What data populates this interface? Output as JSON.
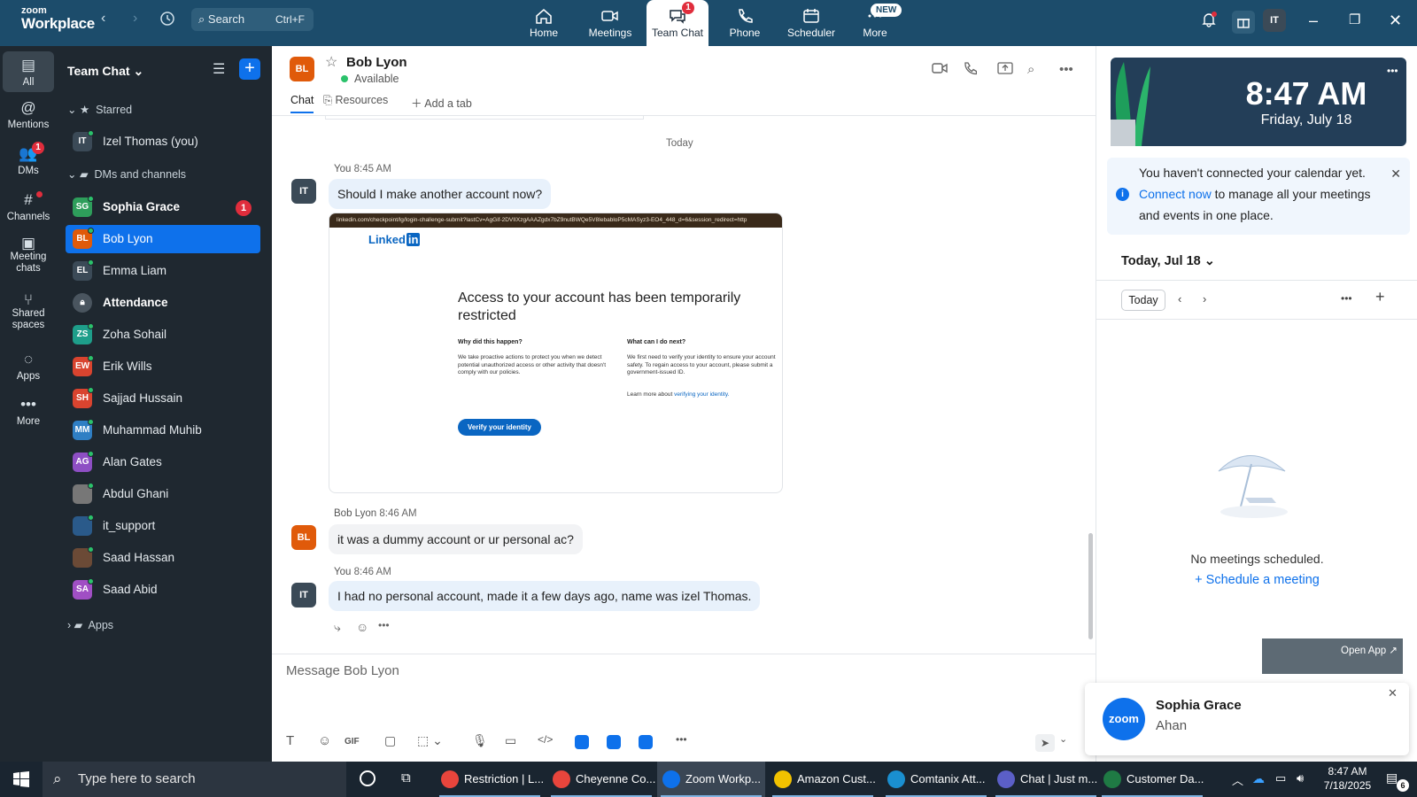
{
  "topbar": {
    "logo_top": "zoom",
    "logo_bottom": "Workplace",
    "search_label": "Search",
    "search_shortcut": "Ctrl+F",
    "tabs": [
      {
        "label": "Home"
      },
      {
        "label": "Meetings"
      },
      {
        "label": "Team Chat",
        "badge": "1"
      },
      {
        "label": "Phone"
      },
      {
        "label": "Scheduler"
      },
      {
        "label": "More",
        "badge": "NEW"
      }
    ],
    "user_initials": "IT"
  },
  "rail": {
    "items": [
      {
        "label": "All"
      },
      {
        "label": "Mentions"
      },
      {
        "label": "DMs",
        "badge": "1"
      },
      {
        "label": "Channels"
      },
      {
        "label": "Meeting chats"
      },
      {
        "label": "Shared spaces"
      },
      {
        "label": "Apps"
      },
      {
        "label": "More"
      }
    ]
  },
  "sidebar": {
    "title": "Team Chat",
    "starred_label": "Starred",
    "dms_label": "DMs and channels",
    "apps_label": "Apps",
    "starred": [
      {
        "initials": "IT",
        "name": "Izel Thomas (you)",
        "color": "#3b4a57"
      }
    ],
    "items": [
      {
        "initials": "SG",
        "name": "Sophia Grace",
        "color": "#2e9e5b",
        "unread": "1"
      },
      {
        "initials": "BL",
        "name": "Bob Lyon",
        "color": "#e05a0a"
      },
      {
        "initials": "EL",
        "name": "Emma Liam",
        "color": "#3b4a57"
      },
      {
        "initials": "",
        "name": "Attendance",
        "color": "#4a555f"
      },
      {
        "initials": "ZS",
        "name": "Zoha Sohail",
        "color": "#1e9e8a"
      },
      {
        "initials": "EW",
        "name": "Erik Wills",
        "color": "#d9442f"
      },
      {
        "initials": "SH",
        "name": "Sajjad Hussain",
        "color": "#d9442f"
      },
      {
        "initials": "MM",
        "name": "Muhammad Muhib",
        "color": "#2f7fc4"
      },
      {
        "initials": "AG",
        "name": "Alan Gates",
        "color": "#8e4fc4"
      },
      {
        "initials": "",
        "name": "Abdul Ghani",
        "color": "#777"
      },
      {
        "initials": "",
        "name": "it_support",
        "color": "#2a5a8a"
      },
      {
        "initials": "",
        "name": "Saad Hassan",
        "color": "#6b4a36"
      },
      {
        "initials": "SA",
        "name": "Saad Abid",
        "color": "#a04fc4"
      }
    ]
  },
  "chat": {
    "contact_initials": "BL",
    "contact_name": "Bob Lyon",
    "status": "Available",
    "tabs": [
      "Chat",
      "Resources",
      "Add a tab"
    ],
    "day_divider": "Today",
    "messages": [
      {
        "sender": "You",
        "time": "8:45 AM",
        "initials": "IT",
        "text": "Should I make another account now?"
      },
      {
        "sender": "Bob Lyon",
        "time": "8:46 AM",
        "initials": "BL",
        "text": "it was a dummy account or ur personal ac?"
      },
      {
        "sender": "You",
        "time": "8:46 AM",
        "initials": "IT",
        "text": "I had no personal account, made it a few days ago, name was izel Thomas."
      }
    ],
    "screenshot": {
      "url": "linkedin.com/checkpoint/lg/login-challenge-submit?lastCv=AgGif-2DVIIXzgAAAZgdx7bZ9nutBWQe5V8IebabloP5cMASyz3-EO4_448_d=6&session_redirect=http",
      "logo": "Linked",
      "logo_box": "in",
      "heading": "Access to your account has been temporarily restricted",
      "why_title": "Why did this happen?",
      "why_text": "We take proactive actions to protect you when we detect potential unauthorized access or other activity that doesn't comply with our policies.",
      "next_title": "What can I do next?",
      "next_text": "We first need to verify your identity to ensure your account safety. To regain access to your account, please submit a government-issued ID.",
      "learn_prefix": "Learn more about",
      "learn_link": "verifying your identity.",
      "button": "Verify your identity"
    },
    "compose_placeholder": "Message Bob Lyon",
    "gif_label": "GIF"
  },
  "right": {
    "time": "8:47 AM",
    "date": "Friday, July 18",
    "note_pre": "You haven't connected your calendar yet.",
    "note_link": "Connect now",
    "note_post": "to manage all your meetings and events in one place.",
    "day_header": "Today, Jul 18",
    "today_btn": "Today",
    "empty_text": "No meetings scheduled.",
    "schedule_link": "Schedule a meeting",
    "open_app": "Open App ↗",
    "toast_name": "Sophia Grace",
    "toast_msg": "Ahan",
    "toast_logo": "zoom"
  },
  "taskbar": {
    "search": "Type here to search",
    "apps": [
      {
        "label": "Restriction | L...",
        "color": "#e8453c"
      },
      {
        "label": "Cheyenne Co...",
        "color": "#e8453c"
      },
      {
        "label": "Zoom Workp...",
        "color": "#0e71eb"
      },
      {
        "label": "Amazon Cust...",
        "color": "#f2c200"
      },
      {
        "label": "Comtanix Att...",
        "color": "#1a8fd0"
      },
      {
        "label": "Chat | Just m...",
        "color": "#5b5fc7"
      },
      {
        "label": "Customer Da...",
        "color": "#1f7a44"
      }
    ],
    "time": "8:47 AM",
    "date": "7/18/2025",
    "notif": "6"
  },
  "colors": {
    "accent": "#0e71eb",
    "topbar": "#1c4c6b",
    "sidebar": "#1f2830"
  }
}
